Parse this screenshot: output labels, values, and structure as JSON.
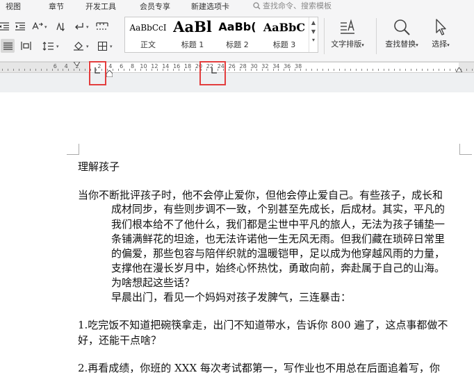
{
  "menu": {
    "items": [
      "视图",
      "章节",
      "开发工具",
      "会员专享",
      "新建选项卡"
    ],
    "search_placeholder": "查找命令、搜索模板"
  },
  "ribbon": {
    "styles": [
      {
        "sample": "AaBbCcI",
        "name": "正文"
      },
      {
        "sample": "AaBl",
        "name": "标题 1"
      },
      {
        "sample": "AaBb(",
        "name": "标题 2"
      },
      {
        "sample": "AaBbC",
        "name": "标题 3"
      }
    ],
    "text_layout_label": "文字排版",
    "find_replace_label": "查找替换",
    "select_label": "选择"
  },
  "ruler": {
    "numbers": [
      "6",
      "4",
      "2",
      "2",
      "4",
      "6",
      "8",
      "10",
      "12",
      "14",
      "16",
      "18",
      "20",
      "22",
      "24",
      "26",
      "28",
      "30",
      "32",
      "34",
      "36",
      "38"
    ]
  },
  "document": {
    "title": "理解孩子",
    "paragraphs": [
      "当你不断批评孩子时，他不会停止爱你，但他会停止爱自己。有些孩子，成长和",
      "成材同步，有些则步调不一致，个别甚至先成长，后成材。其实，平凡的",
      "我们根本给不了他什么，我们都是尘世中平凡的旅人，无法为孩子铺垫一",
      "条铺满鲜花的坦途，也无法许诺他一生无风无雨。但我们藏在琐碎日常里",
      "的偏爱，那些包容与陪伴织就的温暖铠甲，足以成为他穿越风雨的力量，",
      "支撑他在漫长岁月中，始终心怀热忱，勇敢向前，奔赴属于自己的山海。",
      "为啥想起这些话？",
      "早晨出门，看见一个妈妈对孩子发脾气，三连暴击："
    ],
    "item1_line1": "1.吃完饭不知道把碗筷拿走，出门不知道带水，告诉你 800 遍了，这点事都做不",
    "item1_line2": "好，还能干点啥？",
    "item2_line1": "2.再看成绩，你班的 XXX 每次考试都第一，写作业也不用总在后面追着写，你"
  }
}
